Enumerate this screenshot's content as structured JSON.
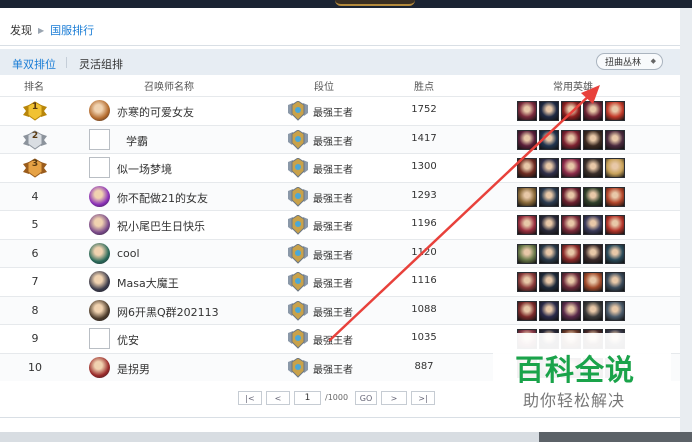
{
  "breadcrumb": {
    "root": "发现",
    "current": "国服排行"
  },
  "modes": {
    "solo": "单双排位",
    "flex": "灵活组排"
  },
  "filter": {
    "selected": "扭曲丛林"
  },
  "table": {
    "headers": {
      "rank": "排名",
      "summoner": "召唤师名称",
      "tier": "段位",
      "points": "胜点",
      "champions": "常用英雄"
    },
    "rows": [
      {
        "rank": "1",
        "medal": "gold-medal-icon",
        "name": "亦寒的可爱女友",
        "avatar_broken": false,
        "avatar_color": "#b36a2c",
        "tier": "最强王者",
        "points": "1752",
        "champs": [
          "#7a2b3c",
          "#1f2a44",
          "#8c1f1f",
          "#6a2234",
          "#c23a2a"
        ]
      },
      {
        "rank": "2",
        "medal": "silver-medal-icon",
        "name": "学霸",
        "avatar_broken": true,
        "avatar_color": "#ffffff",
        "tier": "最强王者",
        "points": "1417",
        "champs": [
          "#5a1f3a",
          "#21344f",
          "#7c2130",
          "#3b2a22",
          "#4a2a3e"
        ]
      },
      {
        "rank": "3",
        "medal": "bronze-medal-icon",
        "name": "似一场梦境",
        "avatar_broken": true,
        "avatar_color": "#ffffff",
        "tier": "最强王者",
        "points": "1300",
        "champs": [
          "#6e2c22",
          "#2f2f4a",
          "#8b2a4a",
          "#3a2f2a",
          "#c8a25a"
        ]
      },
      {
        "rank": "4",
        "medal": "",
        "name": "你不配做21的女友",
        "avatar_broken": false,
        "avatar_color": "#8a2fb8",
        "tier": "最强王者",
        "points": "1293",
        "champs": [
          "#8a6a3a",
          "#2a3a4f",
          "#6a1f2f",
          "#2f3f2a",
          "#b2452a"
        ]
      },
      {
        "rank": "5",
        "medal": "",
        "name": "祝小尾巴生日快乐",
        "avatar_broken": false,
        "avatar_color": "#7a4a8a",
        "tier": "最强王者",
        "points": "1196",
        "champs": [
          "#9a3040",
          "#2a2a3a",
          "#7a2a3a",
          "#3a3a5a",
          "#b3342a"
        ]
      },
      {
        "rank": "6",
        "medal": "",
        "name": "cool",
        "avatar_broken": false,
        "avatar_color": "#2a6a5a",
        "tier": "最强王者",
        "points": "1120",
        "champs": [
          "#6a7a4a",
          "#2a3a4a",
          "#8a2a2a",
          "#3a2a2a",
          "#2a4a5a"
        ]
      },
      {
        "rank": "7",
        "medal": "",
        "name": "Masa大魔王",
        "avatar_broken": false,
        "avatar_color": "#3a3a4a",
        "tier": "最强王者",
        "points": "1116",
        "champs": [
          "#8a3a3a",
          "#1f2a3a",
          "#6a2a3a",
          "#a04a2a",
          "#3a4a5a"
        ]
      },
      {
        "rank": "8",
        "medal": "",
        "name": "网6开黑Q群202113",
        "avatar_broken": false,
        "avatar_color": "#4a3a2a",
        "tier": "最强王者",
        "points": "1088",
        "champs": [
          "#7a2a2a",
          "#2a2a4a",
          "#5a2a4a",
          "#3a3a3a",
          "#4a5a6a"
        ]
      },
      {
        "rank": "9",
        "medal": "",
        "name": "优安",
        "avatar_broken": true,
        "avatar_color": "#ffffff",
        "tier": "最强王者",
        "points": "1035",
        "champs": [
          "#8a3a4a",
          "#2a2a3a",
          "#6a3a2a",
          "#4a2a2a",
          "#3a3a4a"
        ]
      },
      {
        "rank": "10",
        "medal": "",
        "name": "是拐男",
        "avatar_broken": false,
        "avatar_color": "#9a2a2a",
        "tier": "最强王者",
        "points": "887",
        "champs": [
          "#7a2a2a",
          "#2a3a4a",
          "#5a2a3a",
          "#3a2a2a",
          "#4a3a5a"
        ]
      }
    ]
  },
  "pager": {
    "first": "|<",
    "prev": "<",
    "page": "1",
    "total": "/1000",
    "go": "GO",
    "next": ">",
    "last": ">|"
  },
  "watermark": {
    "title": "百科全说",
    "subtitle": "助你轻松解决"
  },
  "colors": {
    "accent": "#1a7dd6",
    "annotation_arrow": "#e8413b",
    "watermark_green": "#1aa34a"
  }
}
